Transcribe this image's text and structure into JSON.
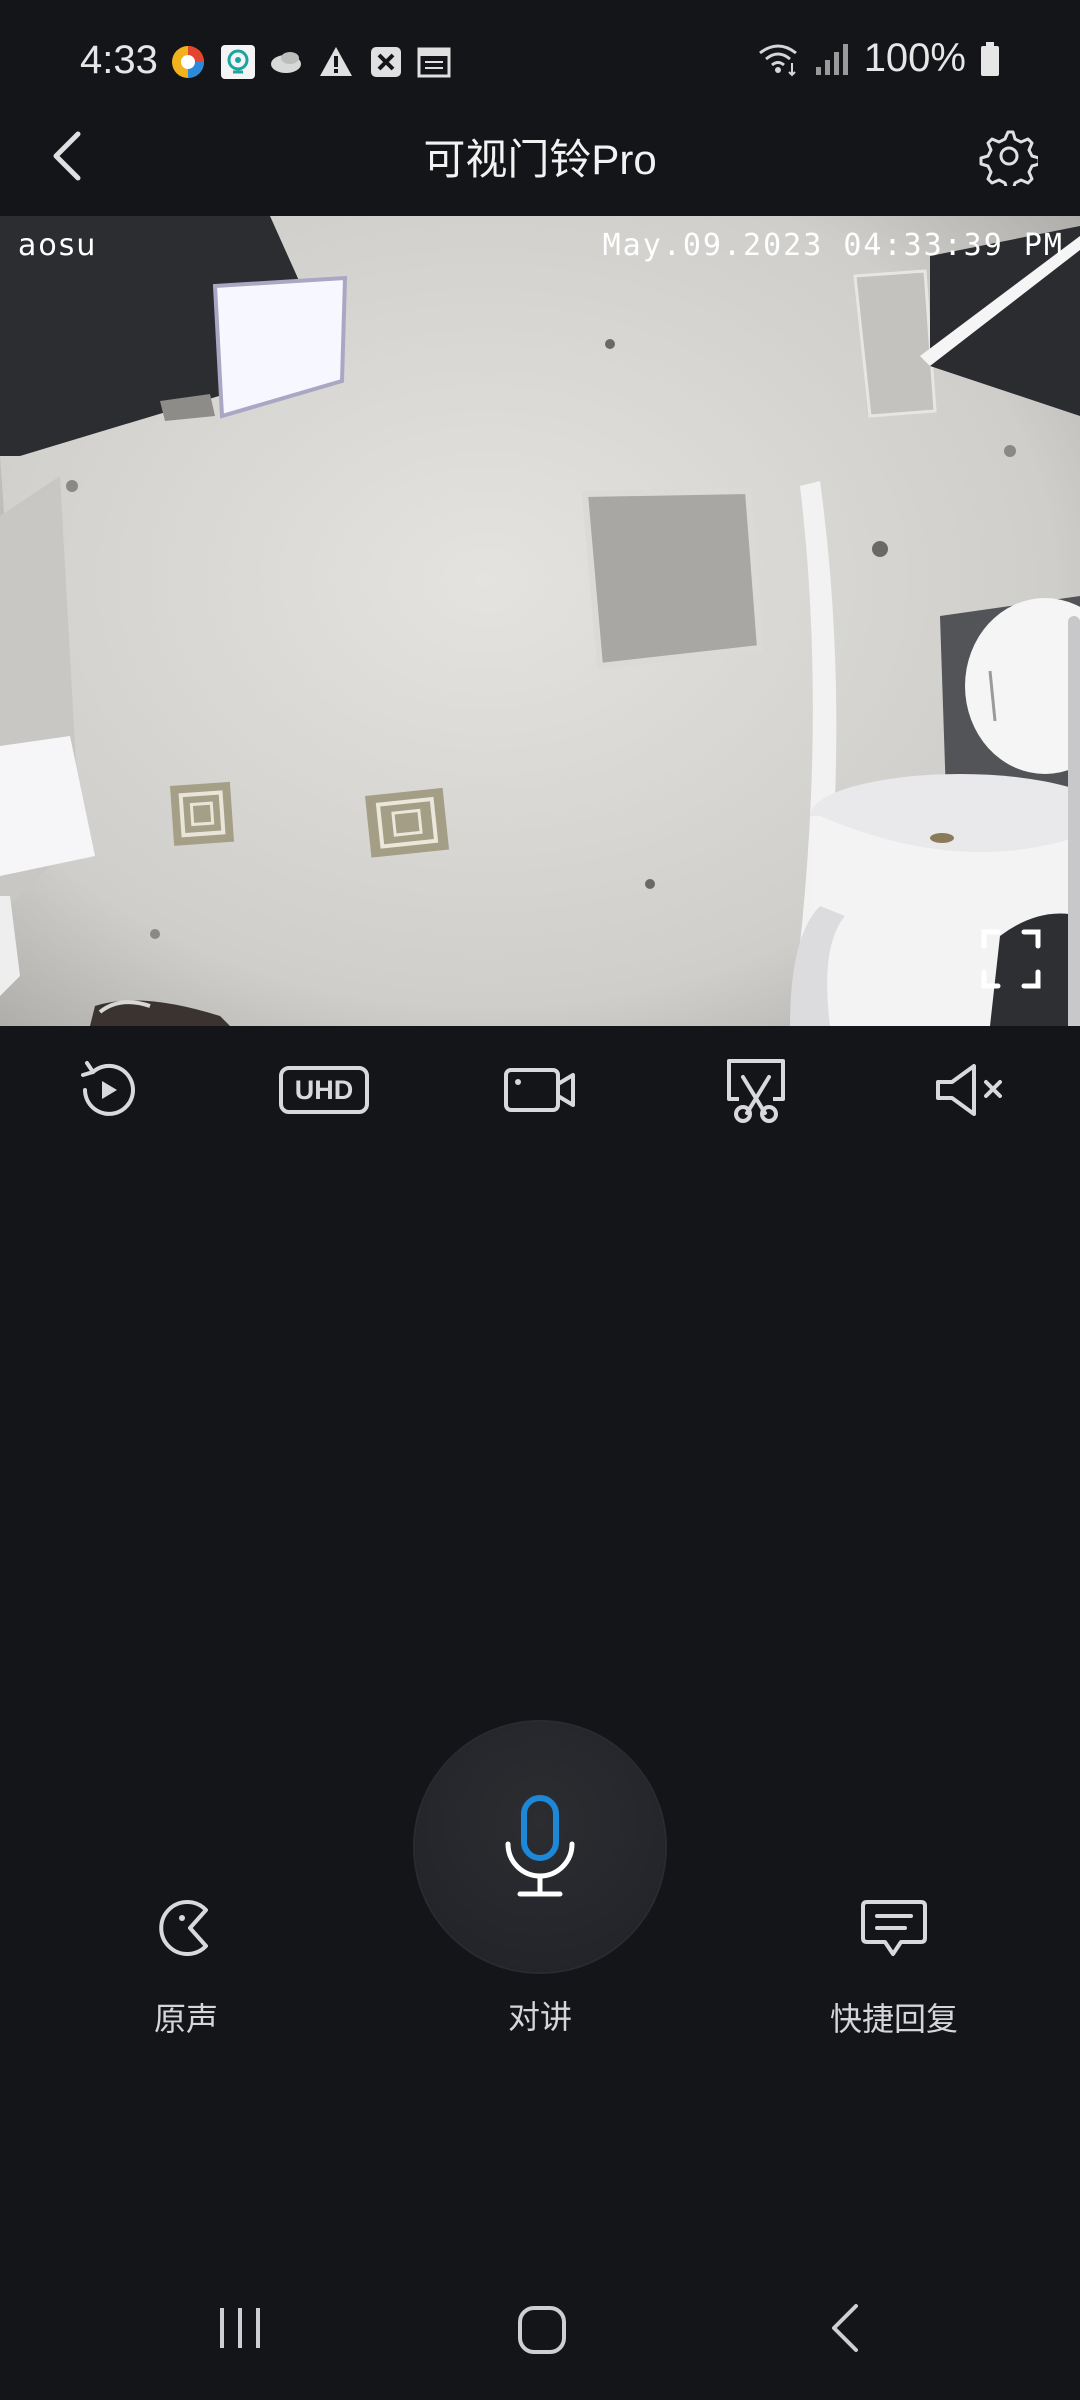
{
  "status": {
    "time": "4:33",
    "battery": "100%",
    "notif_icons": [
      "colorful-app-icon",
      "maps-pin-icon",
      "cloud-icon",
      "warning-icon",
      "close-box-icon",
      "calendar-icon"
    ]
  },
  "header": {
    "title": "可视门铃Pro"
  },
  "video": {
    "brand": "aosu",
    "timestamp": "May.09.2023 04:33:39 PM"
  },
  "toolbar": {
    "uhd_label": "UHD"
  },
  "controls": {
    "original_voice_label": "原声",
    "talk_label": "对讲",
    "quick_reply_label": "快捷回复"
  },
  "colors": {
    "background": "#141519",
    "accent_blue": "#1e88d8",
    "icon": "#d9d9db"
  }
}
